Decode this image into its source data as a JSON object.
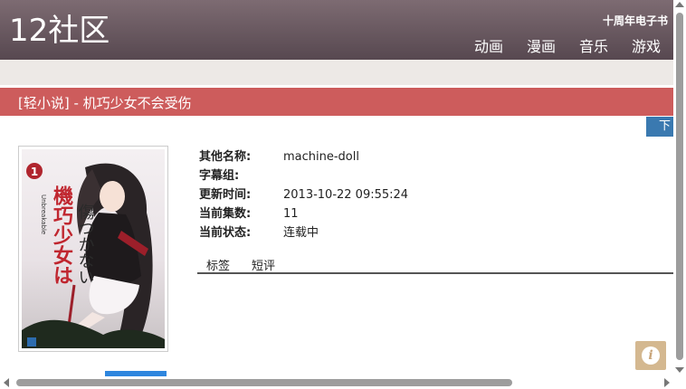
{
  "header": {
    "logo": "12社区",
    "promo": "十周年电子书",
    "nav": [
      "动画",
      "漫画",
      "音乐",
      "游戏"
    ]
  },
  "page": {
    "title": "[轻小说] - 机巧少女不会受伤",
    "download_button": "下"
  },
  "meta": [
    {
      "label": "其他名称:",
      "value": "machine-doll"
    },
    {
      "label": "字幕组:",
      "value": ""
    },
    {
      "label": "更新时间:",
      "value": "2013-10-22 09:55:24"
    },
    {
      "label": "当前集数:",
      "value": "11"
    },
    {
      "label": "当前状态:",
      "value": "连载中"
    }
  ],
  "tabs": [
    "标签",
    "短评"
  ],
  "colors": {
    "header": "#6a5960",
    "titlebar": "#cd5c5c",
    "accent": "#3a79b0",
    "info_button": "#d4b890"
  }
}
